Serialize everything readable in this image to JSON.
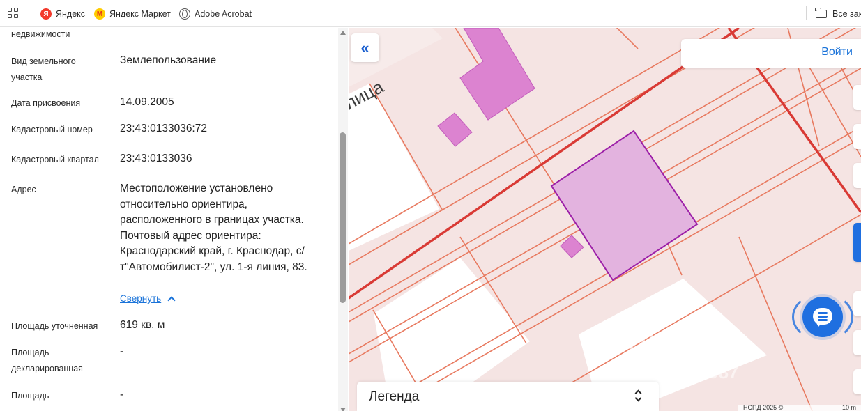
{
  "bookmarks": {
    "items": [
      {
        "label": "Яндекс",
        "icon": "yandex-icon",
        "glyph": "Я"
      },
      {
        "label": "Яндекс Маркет",
        "icon": "yandex-market-icon",
        "glyph": "M"
      },
      {
        "label": "Adobe Acrobat",
        "icon": "globe-icon",
        "glyph": ""
      }
    ],
    "all_bookmarks": "Все закладки"
  },
  "info": {
    "rows": [
      {
        "label": "недвижимости",
        "value": ""
      },
      {
        "label": "Вид земельного участка",
        "value": "Землепользование"
      },
      {
        "label": "Дата присвоения",
        "value": "14.09.2005"
      },
      {
        "label": "Кадастровый номер",
        "value": "23:43:0133036:72"
      },
      {
        "label": "Кадастровый квартал",
        "value": "23:43:0133036"
      },
      {
        "label": "Адрес",
        "value": "Местоположение установлено относительно ориентира, расположенного в границах участка. Почтовый адрес ориентира: Краснодарский край, г. Краснодар, с/т\"Автомобилист-2\", ул. 1-я линия, 83."
      },
      {
        "label": "Площадь уточненная",
        "value": "619 кв. м"
      },
      {
        "label": "Площадь декларированная",
        "value": "-"
      },
      {
        "label": "Площадь",
        "value": "-"
      }
    ],
    "collapse_label": "Свернуть"
  },
  "map": {
    "street_label": "лица",
    "login_label": "Войти",
    "legend_title": "Легенда",
    "watermark": "ЦИАН",
    "watermark_digits": "...7987",
    "scale_text": "НСПД 2025 ©",
    "scale_value": "10 m",
    "colors": {
      "background": "#f5e4e3",
      "parcel_line": "#e8795f",
      "red_road": "#d93a35",
      "building": "#dc83d0",
      "selected_fill": "#e3b3df",
      "selected_border": "#9c1fa8",
      "accent_blue": "#1f6fe0"
    }
  }
}
